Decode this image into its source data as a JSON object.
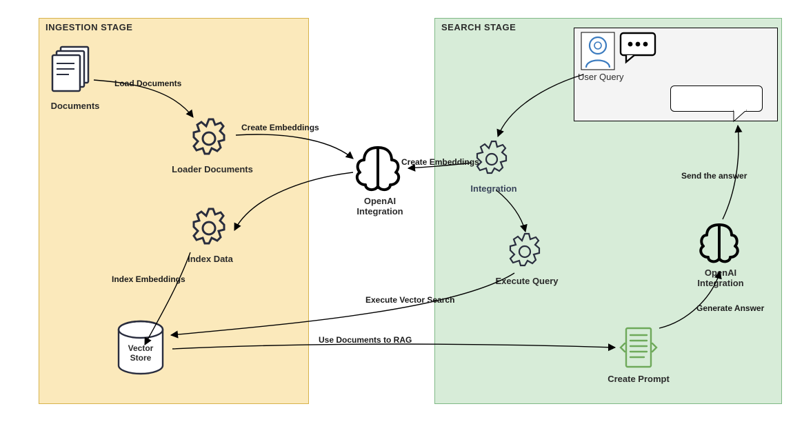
{
  "stages": {
    "ingestion": {
      "title": "INGESTION STAGE",
      "bg": "#fbe9bb",
      "border": "#d6b24a"
    },
    "search": {
      "title": "SEARCH STAGE",
      "bg": "#d7ecd8",
      "border": "#7fb885"
    }
  },
  "nodes": {
    "documents": {
      "label": "Documents"
    },
    "loader_documents": {
      "label": "Loader Documents"
    },
    "index_data": {
      "label": "Index Data"
    },
    "vector_store": {
      "label": "Vector\nStore"
    },
    "openai_center": {
      "label": "OpenAI\nIntegration"
    },
    "user_query": {
      "label": "User Query"
    },
    "integration": {
      "label": "Integration"
    },
    "execute_query": {
      "label": "Execute Query"
    },
    "create_prompt": {
      "label": "Create Prompt"
    },
    "openai_right": {
      "label": "OpenAI\nIntegration"
    }
  },
  "edges": {
    "load_documents": {
      "label": "Load Documents"
    },
    "create_embeddings_1": {
      "label": "Create Embeddings"
    },
    "create_embeddings_2": {
      "label": "Create Embeddings"
    },
    "index_embeddings": {
      "label": "Index Embeddings"
    },
    "execute_vector_search": {
      "label": "Execute Vector Search"
    },
    "use_documents_to_rag": {
      "label": "Use Documents to RAG"
    },
    "generate_answer": {
      "label": "Generate Answer"
    },
    "send_the_answer": {
      "label": "Send the answer"
    }
  }
}
